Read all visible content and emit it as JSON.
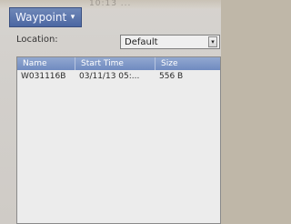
{
  "header": {
    "menu_label": "Waypoint",
    "menu_icon": "chevron-down-icon",
    "status_text": "10:13 ..."
  },
  "location": {
    "label": "Location:",
    "selected": "Default"
  },
  "table": {
    "headers": {
      "name": "Name",
      "start_time": "Start Time",
      "size": "Size"
    },
    "rows": [
      {
        "name": "W031116B",
        "start_time": "03/11/13 05:...",
        "size": "556 B"
      }
    ]
  }
}
